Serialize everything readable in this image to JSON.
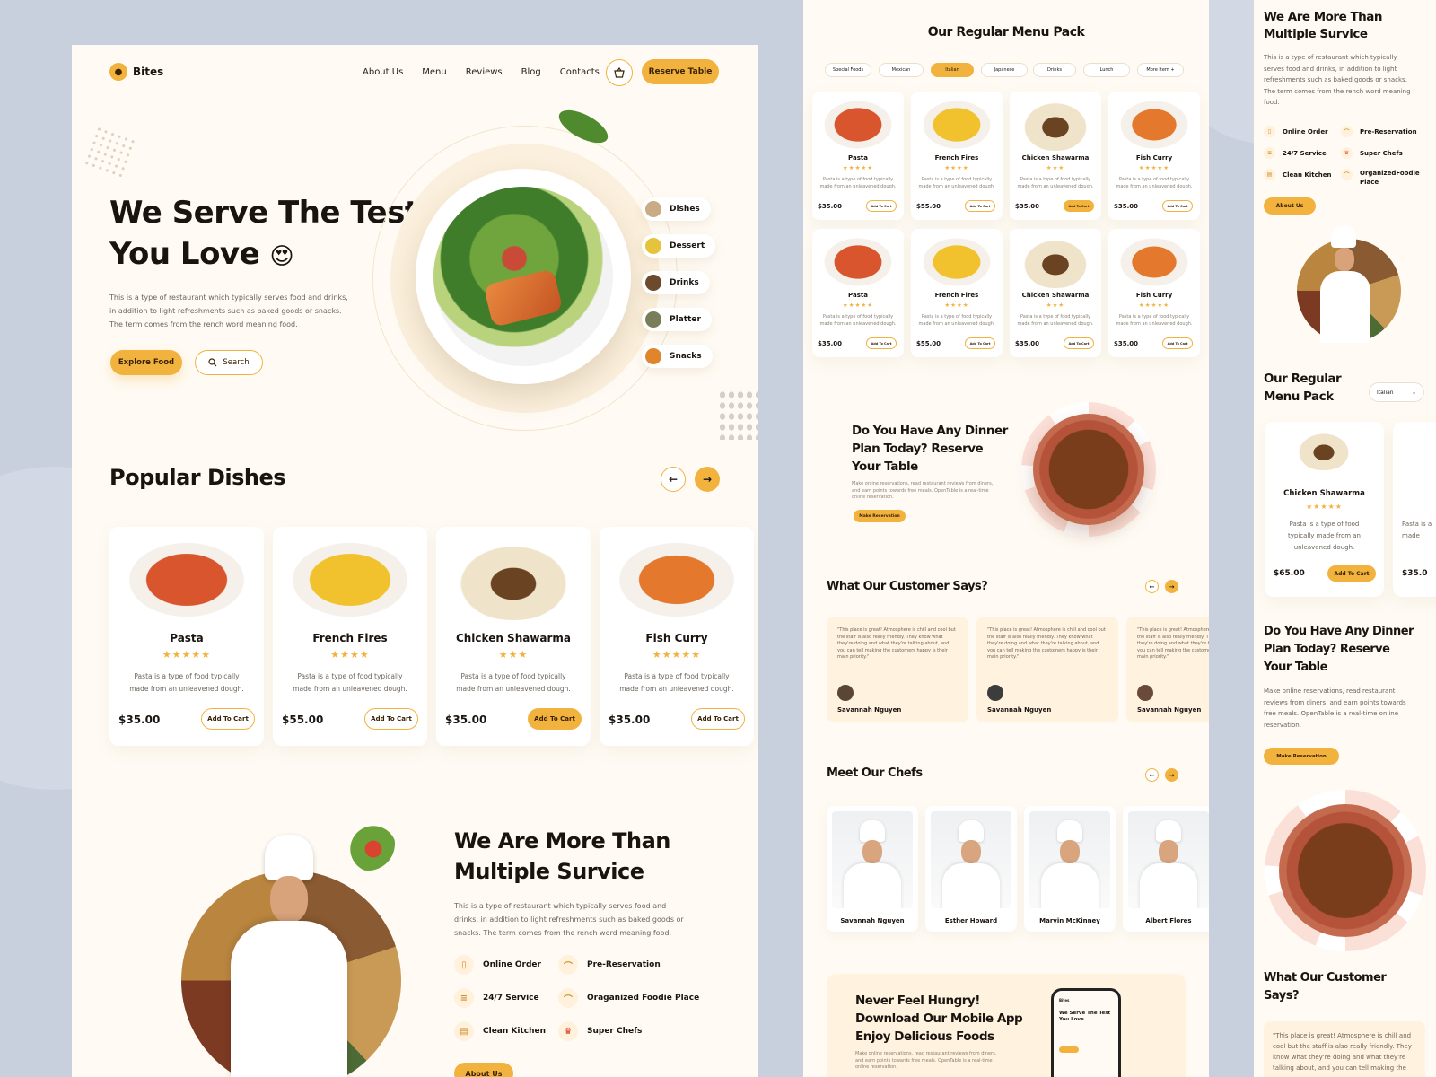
{
  "brand": {
    "name": "Bites"
  },
  "nav": {
    "links": [
      "About Us",
      "Menu",
      "Reviews",
      "Blog",
      "Contacts"
    ],
    "reserve": "Reserve Table"
  },
  "hero": {
    "title_line1": "We Serve The Test",
    "title_line2": "You Love",
    "emoji": "😍",
    "description": "This is a type of restaurant which typically serves food and drinks, in addition to light refreshments such as baked goods or snacks. The term comes from the rench word meaning food.",
    "explore": "Explore Food",
    "search": "Search",
    "categories": [
      "Dishes",
      "Dessert",
      "Drinks",
      "Platter",
      "Snacks"
    ]
  },
  "popular": {
    "title": "Popular Dishes",
    "add_to_cart": "Add To Cart",
    "items": [
      {
        "name": "Pasta",
        "stars": "★★★★★",
        "desc": "Pasta is a type of food typically made from an unleavened dough.",
        "price": "$35.00"
      },
      {
        "name": "French Fires",
        "stars": "★★★★",
        "desc": "Pasta is a type of food typically made from an unleavened dough.",
        "price": "$55.00"
      },
      {
        "name": "Chicken Shawarma",
        "stars": "★★★",
        "desc": "Pasta is a type of food typically made from an unleavened dough.",
        "price": "$35.00"
      },
      {
        "name": "Fish Curry",
        "stars": "★★★★★",
        "desc": "Pasta is a type of food typically made from an unleavened dough.",
        "price": "$35.00"
      }
    ]
  },
  "services": {
    "title_line1": "We Are More Than",
    "title_line2": "Multiple Survice",
    "description": "This is a type of restaurant which typically serves food and drinks, in addition to light refreshments such as baked goods or snacks. The term comes from the rench word meaning food.",
    "items": [
      "Online Order",
      "Pre-Reservation",
      "24/7 Service",
      "Oraganized Foodie Place",
      "Clean Kitchen",
      "Super Chefs"
    ],
    "about": "About Us"
  },
  "menu_pack": {
    "title": "Our Regular Menu Pack",
    "filters": [
      "Special Foods",
      "Mexican",
      "Italian",
      "Japanese",
      "Drinks",
      "Lunch",
      "More Item +"
    ],
    "active_filter": "Italian",
    "add_to_cart": "Add To Cart",
    "card_desc": "Pasta is a type of food typically made from an unleavened dough.",
    "items": [
      {
        "name": "Pasta",
        "stars": "★★★★★",
        "price": "$35.00"
      },
      {
        "name": "French Fires",
        "stars": "★★★★",
        "price": "$55.00"
      },
      {
        "name": "Chicken Shawarma",
        "stars": "★★★",
        "price": "$35.00"
      },
      {
        "name": "Fish Curry",
        "stars": "★★★★★",
        "price": "$35.00"
      },
      {
        "name": "Pasta",
        "stars": "★★★★★",
        "price": "$35.00"
      },
      {
        "name": "French Fires",
        "stars": "★★★★",
        "price": "$55.00"
      },
      {
        "name": "Chicken Shawarma",
        "stars": "★★★",
        "price": "$35.00"
      },
      {
        "name": "Fish Curry",
        "stars": "★★★★★",
        "price": "$35.00"
      }
    ]
  },
  "reserve_section": {
    "title_line1": "Do You Have Any Dinner",
    "title_line2": "Plan Today? Reserve",
    "title_line3": "Your Table",
    "description": "Make online reservations, read restaurant reviews from diners, and earn points towards free meals. OpenTable is a real-time online reservation.",
    "button": "Make Reservation"
  },
  "testimonials": {
    "title": "What Our Customer Says?",
    "quote": "\"This place is great! Atmosphere is chill and cool but the staff is also really friendly. They know what they're doing and what they're talking about, and you can tell making the customers happy is their main priority.\"",
    "author": "Savannah Nguyen"
  },
  "chefs": {
    "title": "Meet Our Chefs",
    "names": [
      "Savannah Nguyen",
      "Esther Howard",
      "Marvin McKinney",
      "Albert Flores"
    ]
  },
  "app": {
    "title_line1": "Never Feel Hungry!",
    "title_line2": "Download Our Mobile App",
    "title_line3": "Enjoy Delicious Foods",
    "description": "Make online reservations, read restaurant reviews from diners, and earn points towards free meals. OpenTable is a real-time online reservation."
  },
  "mobile": {
    "services_title_line1": "We Are More Than",
    "services_title_line2": "Multiple Survice",
    "services_desc": "This is a type of restaurant which typically serves food and drinks, in addition to light refreshments such as baked goods or snacks. The term comes from the rench word meaning food.",
    "services": [
      "Online Order",
      "Pre-Reservation",
      "24/7 Service",
      "Super Chefs",
      "Clean Kitchen",
      "OrganizedFoodie Place"
    ],
    "about": "About Us",
    "menu_title_line1": "Our Regular",
    "menu_title_line2": "Menu Pack",
    "select_value": "Italian",
    "card": {
      "name": "Chicken Shawarma",
      "stars": "★★★★★",
      "desc": "Pasta is a type of food typically made from an unleavened dough.",
      "price": "$65.00",
      "cart": "Add To Cart"
    },
    "card2_price": "$35.0",
    "card2_desc": "Pasta is a made",
    "reserve_line1": "Do You Have Any Dinner",
    "reserve_line2": "Plan Today? Reserve",
    "reserve_line3": "Your Table",
    "reserve_desc": "Make online reservations, read restaurant reviews from diners, and earn points towards free meals. OpenTable is a real-time online reservation.",
    "reserve_btn": "Make Reservation",
    "testimonial_line1": "What Our Customer",
    "testimonial_line2": "Says?",
    "quote": "\"This place is great! Atmosphere is chill and cool but the staff is also really friendly. They know what they're doing and what they're talking about, and you can tell making the"
  },
  "colors": {
    "accent": "#f2b23e",
    "background": "#fffbf4",
    "canvas": "#c8d0de"
  }
}
